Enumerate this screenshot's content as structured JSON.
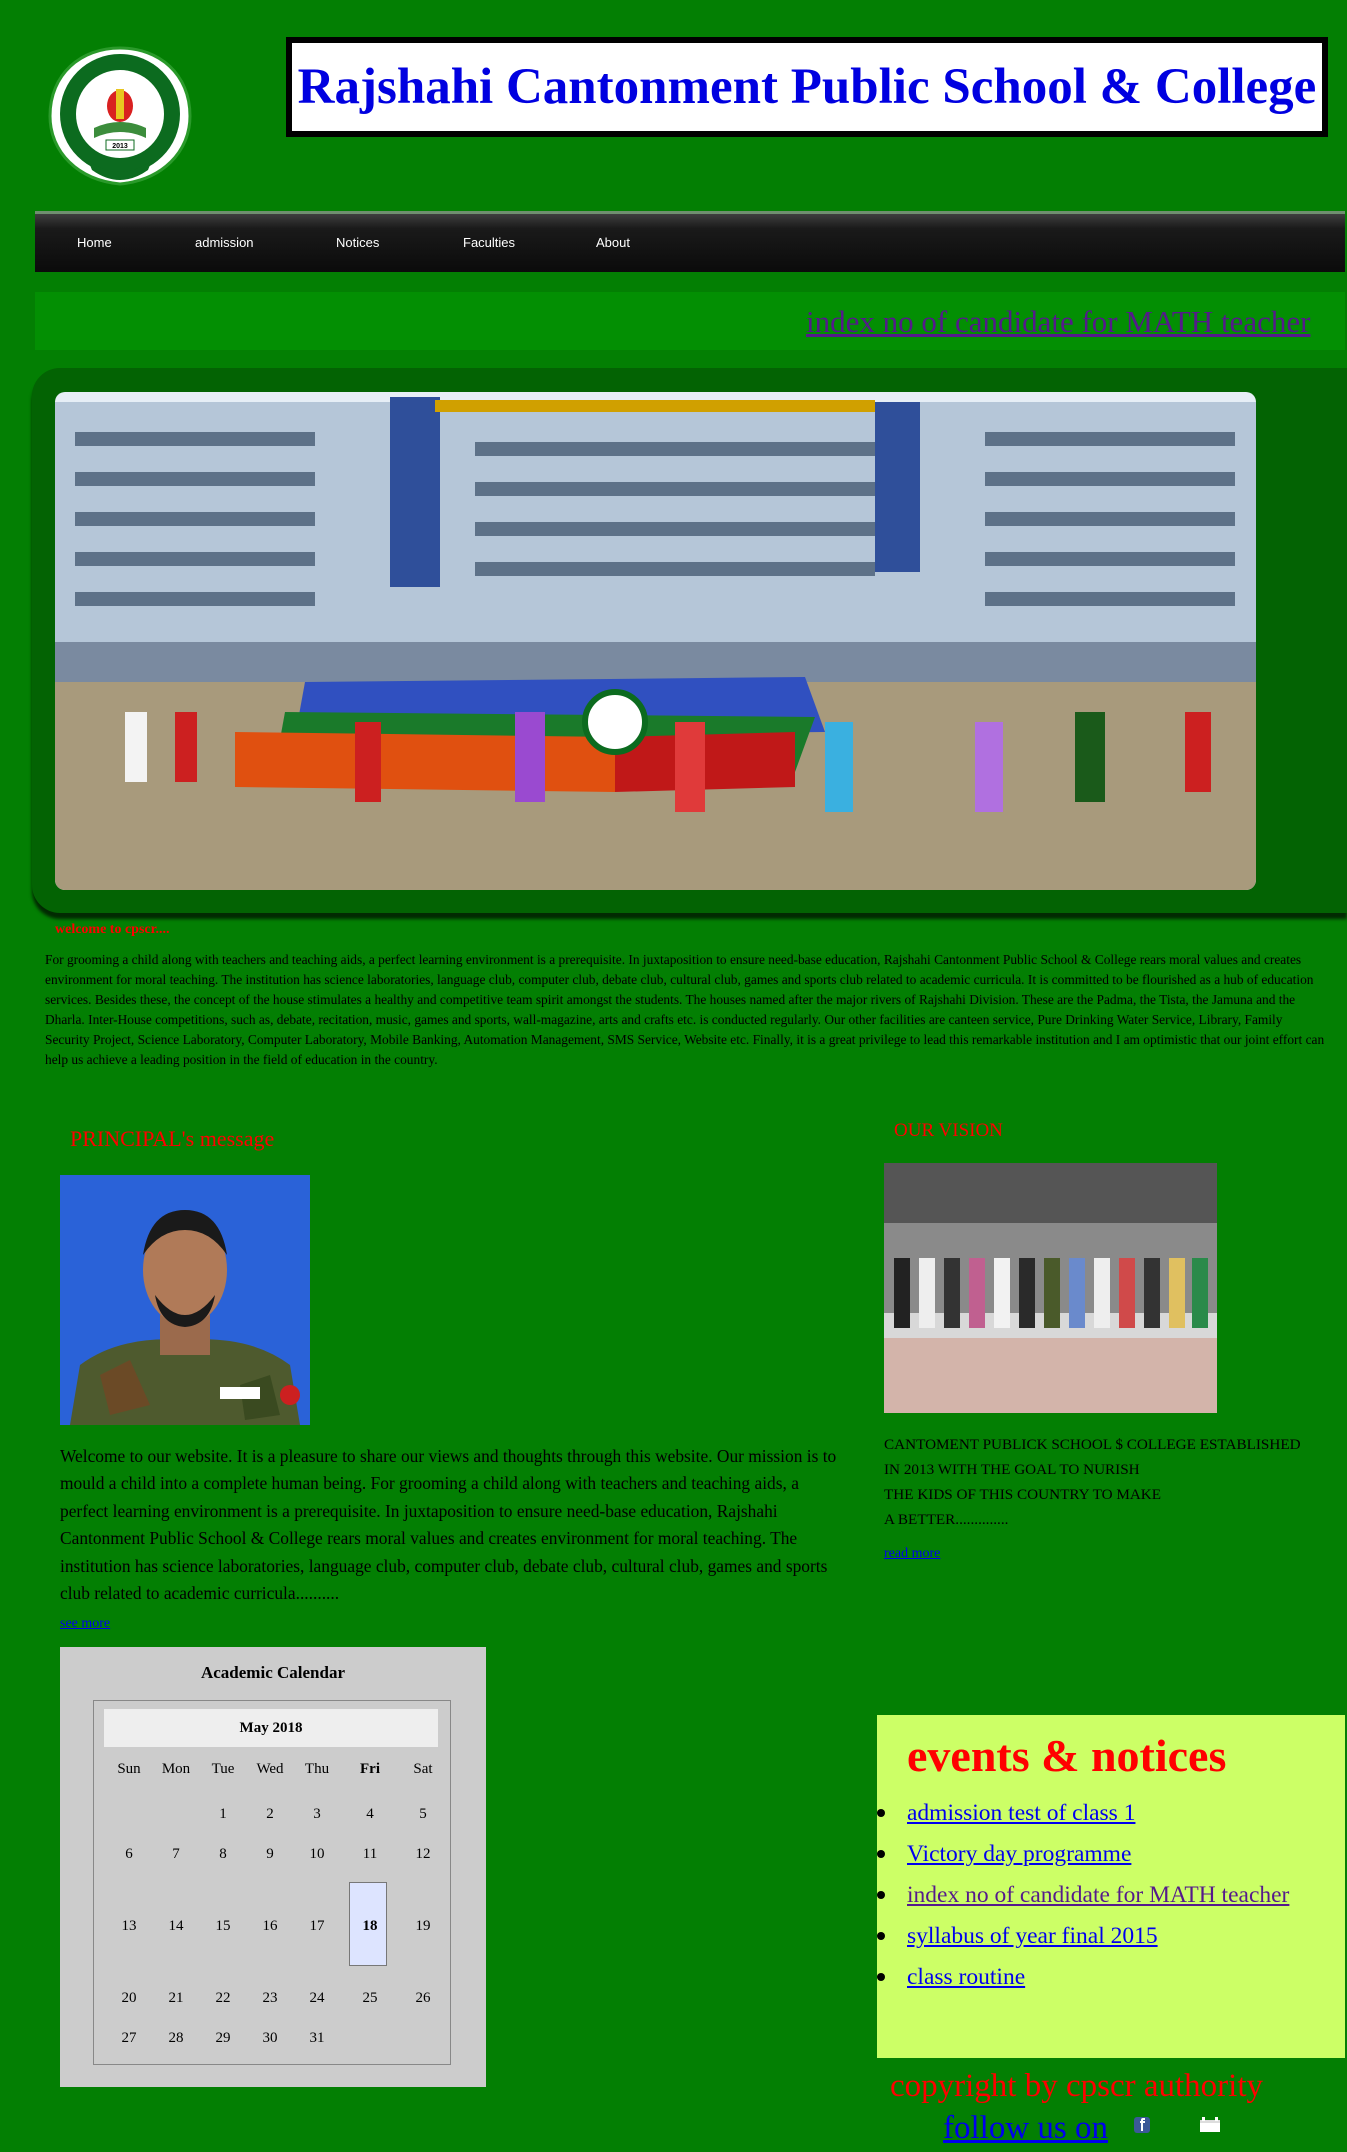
{
  "header": {
    "title": "Rajshahi Cantonment Public School & College",
    "logo": {
      "ring_text_top": "RAJSHAHI CANTONMENT PUBLIC SCHOOL & COLLEGE",
      "ring_text_bottom": "READ IN THE NAME OF YOUR LORD WHO HAS CREATED",
      "year": "2013"
    }
  },
  "nav": {
    "items": [
      "Home",
      "admission",
      "Notices",
      "Faculties",
      "About"
    ]
  },
  "marquee": {
    "text": "index no of candidate for MATH teacher"
  },
  "welcome": {
    "heading": "welcome to cpscr....",
    "body": "For grooming a child along with teachers and teaching aids, a perfect learning environment is a prerequisite. In juxtaposition to ensure need-base education, Rajshahi Cantonment Public School & College rears moral values and creates environment for moral teaching. The institution has science laboratories, language club, computer club, debate club, cultural club, games and sports club related to academic curricula. It is committed to be flourished as a hub of education services. Besides these, the concept of the house stimulates a healthy and competitive team spirit amongst the students. The houses named after the major rivers of Rajshahi Division. These are the Padma, the Tista, the Jamuna and the Dharla. Inter-House competitions, such as, debate, recitation, music, games and sports, wall-magazine, arts and crafts etc. is conducted regularly. Our other facilities are canteen service, Pure Drinking Water Service, Library, Family Security Project, Science Laboratory, Computer Laboratory, Mobile Banking, Automation Management, SMS Service, Website etc. Finally, it is a great privilege to lead this remarkable institution and I am optimistic that our joint effort can help us achieve a leading position in the field of education in the country."
  },
  "principal": {
    "heading": "PRINCIPAL's message",
    "message": "Welcome to our website. It is a pleasure to share our views and thoughts through this website. Our mission is to mould a child into a complete human being. For grooming a child along with teachers and teaching aids, a perfect learning environment is a prerequisite. In juxtaposition to ensure need-base education, Rajshahi Cantonment Public School & College rears moral values and creates environment for moral teaching. The institution has science laboratories, language club, computer club, debate club, cultural club, games and sports club related to academic curricula..........",
    "see_more": "see more"
  },
  "vision": {
    "heading": "OUR VISION",
    "lines": [
      "CANTOMENT PUBLICK SCHOOL $ COLLEGE ESTABLISHED",
      "IN 2013 WITH THE GOAL TO NURISH",
      "THE KIDS OF THIS COUNTRY TO MAKE",
      "A BETTER.............."
    ],
    "read_more": "read more"
  },
  "calendar": {
    "title": "Academic Calendar",
    "month": "May 2018",
    "days_of_week": [
      "Sun",
      "Mon",
      "Tue",
      "Wed",
      "Thu",
      "Fri",
      "Sat"
    ],
    "weeks": [
      [
        "",
        "",
        "1",
        "2",
        "3",
        "4",
        "5"
      ],
      [
        "6",
        "7",
        "8",
        "9",
        "10",
        "11",
        "12"
      ],
      [
        "13",
        "14",
        "15",
        "16",
        "17",
        "18",
        "19"
      ],
      [
        "20",
        "21",
        "22",
        "23",
        "24",
        "25",
        "26"
      ],
      [
        "27",
        "28",
        "29",
        "30",
        "31",
        "",
        ""
      ]
    ],
    "today": "18"
  },
  "events": {
    "heading": "events & notices",
    "items": [
      {
        "label": "admission test of class 1",
        "visited": false
      },
      {
        "label": "Victory day programme",
        "visited": false
      },
      {
        "label": "index no of candidate for MATH teacher",
        "visited": true
      },
      {
        "label": "syllabus of year final 2015",
        "visited": false
      },
      {
        "label": "class routine",
        "visited": false
      }
    ]
  },
  "footer": {
    "copyright": "copyright by cpscr authority",
    "follow": "follow us on",
    "icons": [
      "facebook-icon",
      "social-icon"
    ]
  },
  "colors": {
    "page_bg": "#037f03",
    "title_blue": "#0000e0",
    "accent_red": "#ff0000",
    "events_bg": "#ccff66"
  }
}
